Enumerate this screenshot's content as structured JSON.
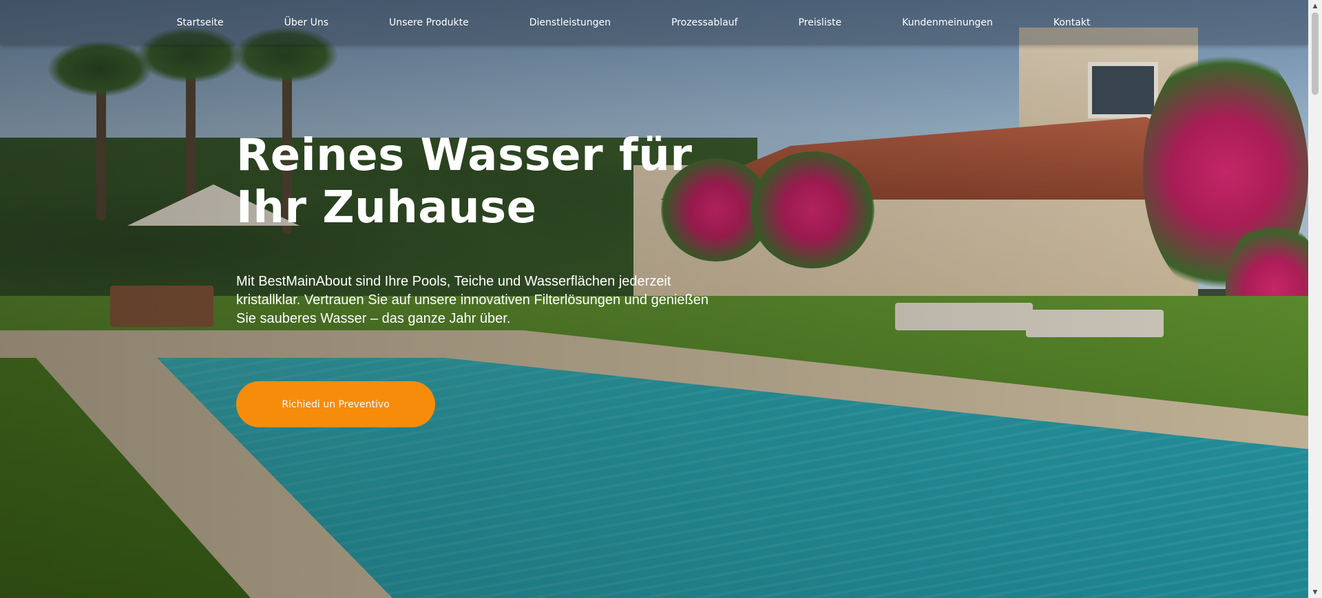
{
  "navigation": {
    "items": [
      {
        "label": "Startseite"
      },
      {
        "label": "Über Uns"
      },
      {
        "label": "Unsere Produkte"
      },
      {
        "label": "Dienstleistungen"
      },
      {
        "label": "Prozessablauf"
      },
      {
        "label": "Preisliste"
      },
      {
        "label": "Kundenmeinungen"
      },
      {
        "label": "Kontakt"
      }
    ]
  },
  "hero": {
    "title_line1": "Reines Wasser für",
    "title_line2": "Ihr Zuhause",
    "text": "Mit BestMainAbout sind Ihre Pools, Teiche und Wasserflächen jederzeit kristallklar. Vertrauen Sie auf unsere innovativen Filterlösungen und genießen Sie sauberes Wasser – das ganze Jahr über.",
    "cta_label": "Richiedi un Preventivo"
  },
  "scrollbar": {
    "up_icon": "▲",
    "down_icon": "▼"
  },
  "colors": {
    "accent": "#f78c0b",
    "text": "#ffffff"
  }
}
